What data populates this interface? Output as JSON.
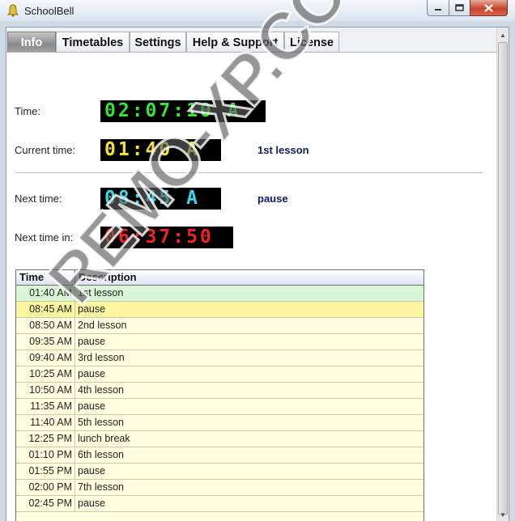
{
  "window": {
    "title": "SchoolBell"
  },
  "tabs": [
    {
      "label": "Info"
    },
    {
      "label": "Timetables"
    },
    {
      "label": "Settings"
    },
    {
      "label": "Help & Support"
    },
    {
      "label": "License"
    }
  ],
  "info": {
    "time_label": "Time:",
    "time_value": "02:07:10 A",
    "current_label": "Current time:",
    "current_value": "01:40 A",
    "current_desc": "1st lesson",
    "next_label": "Next time:",
    "next_value": "08:45 A",
    "next_desc": "pause",
    "next_in_label": "Next time in:",
    "next_in_value": "06:37:50"
  },
  "table": {
    "headers": [
      "Time",
      "Description"
    ],
    "rows": [
      {
        "time": "01:40 AM",
        "desc": "1st lesson"
      },
      {
        "time": "08:45 AM",
        "desc": "pause"
      },
      {
        "time": "08:50 AM",
        "desc": "2nd lesson"
      },
      {
        "time": "09:35 AM",
        "desc": "pause"
      },
      {
        "time": "09:40 AM",
        "desc": "3rd lesson"
      },
      {
        "time": "10:25 AM",
        "desc": "pause"
      },
      {
        "time": "10:50 AM",
        "desc": "4th lesson"
      },
      {
        "time": "11:35 AM",
        "desc": "pause"
      },
      {
        "time": "11:40 AM",
        "desc": "5th lesson"
      },
      {
        "time": "12:25 PM",
        "desc": "lunch break"
      },
      {
        "time": "01:10 PM",
        "desc": "6th lesson"
      },
      {
        "time": "01:55 PM",
        "desc": "pause"
      },
      {
        "time": "02:00 PM",
        "desc": "7th lesson"
      },
      {
        "time": "02:45 PM",
        "desc": "pause"
      }
    ]
  },
  "watermark": "REMO-XP.COM",
  "colors": {
    "led_green": "#39e23a",
    "led_yellow": "#f1e23a",
    "led_cyan": "#36d9ea",
    "led_red": "#f22323",
    "current_row": "#d8f5d5",
    "next_row": "#fdf6a0",
    "row_bg": "#ffffe0"
  },
  "icons": {
    "app": "bell-icon",
    "minimize": "minimize-icon",
    "maximize": "maximize-icon",
    "close": "close-icon"
  }
}
